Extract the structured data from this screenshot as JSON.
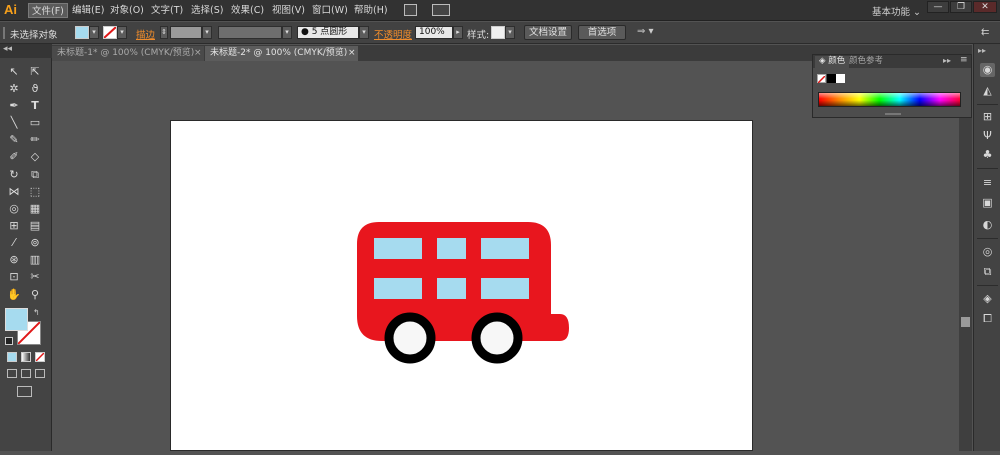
{
  "app": {
    "logo": "Ai"
  },
  "menu": [
    "文件(F)",
    "编辑(E)",
    "对象(O)",
    "文字(T)",
    "选择(S)",
    "效果(C)",
    "视图(V)",
    "窗口(W)",
    "帮助(H)"
  ],
  "workspace": {
    "label": "基本功能"
  },
  "window_controls": {
    "minimize": "—",
    "restore": "❐",
    "close": "✕"
  },
  "controlbar": {
    "selection_status": "未选择对象",
    "fill_color": "#a6dbef",
    "stroke_label": "描边",
    "brush_label": "5 点圆形",
    "opacity_label": "不透明度",
    "opacity_value": "100%",
    "style_label": "样式:",
    "doc_setup_button": "文档设置",
    "preferences_button": "首选项"
  },
  "tabs": [
    {
      "label": "未标题-1* @ 100% (CMYK/预览)",
      "active": false
    },
    {
      "label": "未标题-2* @ 100% (CMYK/预览)",
      "active": true
    }
  ],
  "color_panel": {
    "tab_color": "颜色",
    "tab_color_guide": "颜色参考"
  },
  "colors": {
    "bus_body": "#e8161e",
    "bus_window": "#a6dbef",
    "wheel_rim": "#000000",
    "wheel_hub": "#f7f7f7",
    "fill_swatch": "#a6dbef",
    "accent_orange": "#f08c2b"
  },
  "artwork": {
    "subject": "red double-decker bus with light blue windows"
  }
}
